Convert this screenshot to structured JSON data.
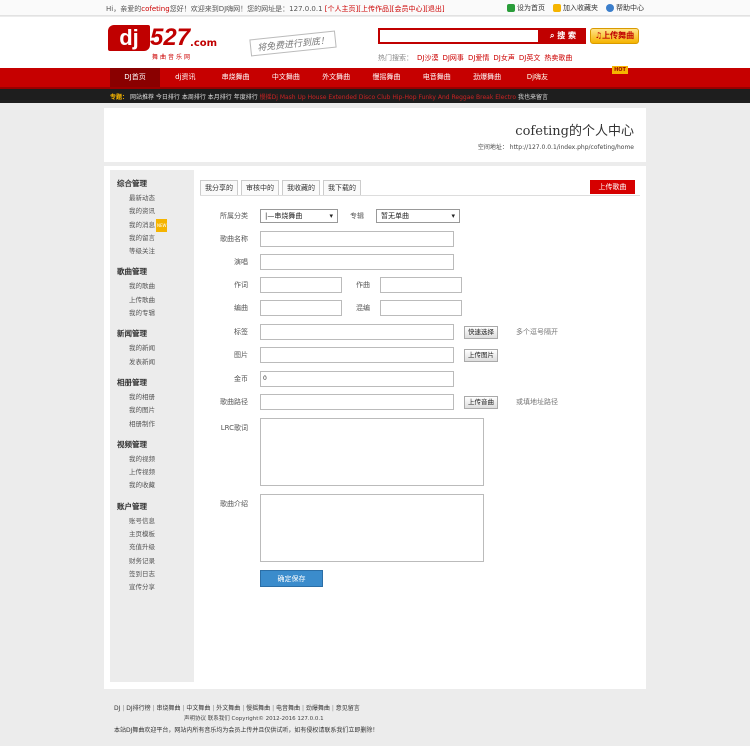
{
  "topbar": {
    "welcome_prefix": "Hi，亲爱的",
    "username": "cofeting",
    "welcome_mid": "您好！欢迎来到DJ嗨网！您的网址是：127.0.0.1",
    "links": [
      "[个人主页]",
      "[上传作品]",
      "[会员中心]",
      "[退出]"
    ],
    "right_links": [
      "设为首页",
      "加入收藏夹",
      "帮助中心"
    ]
  },
  "header": {
    "logo_dj": "dj",
    "logo_num": "527",
    "logo_com": ".com",
    "logo_sub": "舞曲音乐网",
    "slogan": "将免费进行到底！",
    "search_button": "搜 索",
    "upload_button": "上传舞曲",
    "hot_label": "热门搜索：",
    "hot_words": [
      "DJ沙漠",
      "DJ网事",
      "DJ爱情",
      "DJ女声",
      "DJ英文",
      "热卖歌曲"
    ]
  },
  "nav": {
    "items": [
      "DJ首页",
      "dj资讯",
      "串烧舞曲",
      "中文舞曲",
      "外文舞曲",
      "慢摇舞曲",
      "电音舞曲",
      "劲爆舞曲",
      "Dj嗨友"
    ],
    "hot_badge": "HOT"
  },
  "subnav": {
    "tag": "专题：",
    "items": [
      "网站推荐",
      "今日排行",
      "本周排行",
      "本月排行",
      "年度排行"
    ],
    "styles": "慢摇Dj Mash Up House Extended Disco Club Hip-Hop Funky And Reggae Break Electro",
    "extra": "我也来留言"
  },
  "profile": {
    "title": "cofeting的个人中心",
    "url_label": "空间地址：",
    "url": "http://127.0.0.1/index.php/cofeting/home"
  },
  "sidebar": {
    "groups": [
      {
        "title": "综合管理",
        "items": [
          "最新动态",
          "我的资讯",
          "我的消息",
          "我的留言",
          "等级关注"
        ]
      },
      {
        "title": "歌曲管理",
        "items": [
          "我的歌曲",
          "上传歌曲",
          "我的专辑"
        ]
      },
      {
        "title": "新闻管理",
        "items": [
          "我的新闻",
          "发表新闻"
        ]
      },
      {
        "title": "相册管理",
        "items": [
          "我的相册",
          "我的图片",
          "相册制作"
        ]
      },
      {
        "title": "视频管理",
        "items": [
          "我的视频",
          "上传视频",
          "我的收藏"
        ]
      },
      {
        "title": "账户管理",
        "items": [
          "账号信息",
          "主页模板",
          "充值升级",
          "财务记录",
          "签到日志",
          "宣传分享"
        ]
      }
    ],
    "new_badge": "NEW"
  },
  "tabs": [
    "我分享的",
    "审核中的",
    "我收藏的",
    "我下载的"
  ],
  "upload_song_button": "上传歌曲",
  "form": {
    "category_label": "所属分类",
    "category_value": "|—串烧舞曲",
    "album_label": "专辑",
    "album_value": "暂无单曲",
    "name_label": "歌曲名称",
    "singer_label": "演唱",
    "lyricist_label": "作词",
    "composer_label": "作曲",
    "arranger_label": "编曲",
    "mixer_label": "混编",
    "tags_label": "标签",
    "tags_button": "快速选择",
    "tags_hint": "多个逗号隔开",
    "image_label": "图片",
    "image_button": "上传图片",
    "coins_label": "金币",
    "coins_value": "0",
    "path_label": "歌曲路径",
    "path_button": "上传音曲",
    "path_hint": "或填地址路径",
    "lrc_label": "LRC歌词",
    "intro_label": "歌曲介绍",
    "save_button": "确定保存"
  },
  "footer": {
    "links": [
      "DJ",
      "DJ排行榜",
      "串烧舞曲",
      "中文舞曲",
      "外文舞曲",
      "慢摇舞曲",
      "电音舞曲",
      "劲爆舞曲",
      "意见留言"
    ],
    "copy": "声明协议 联系我们 Copyright© 2012-2016 127.0.0.1",
    "statement": "本站DJ舞曲欢迎平台，网站内所有音乐均为会员上传并且仅供试听，如有侵权请联系我们立即删除！"
  }
}
